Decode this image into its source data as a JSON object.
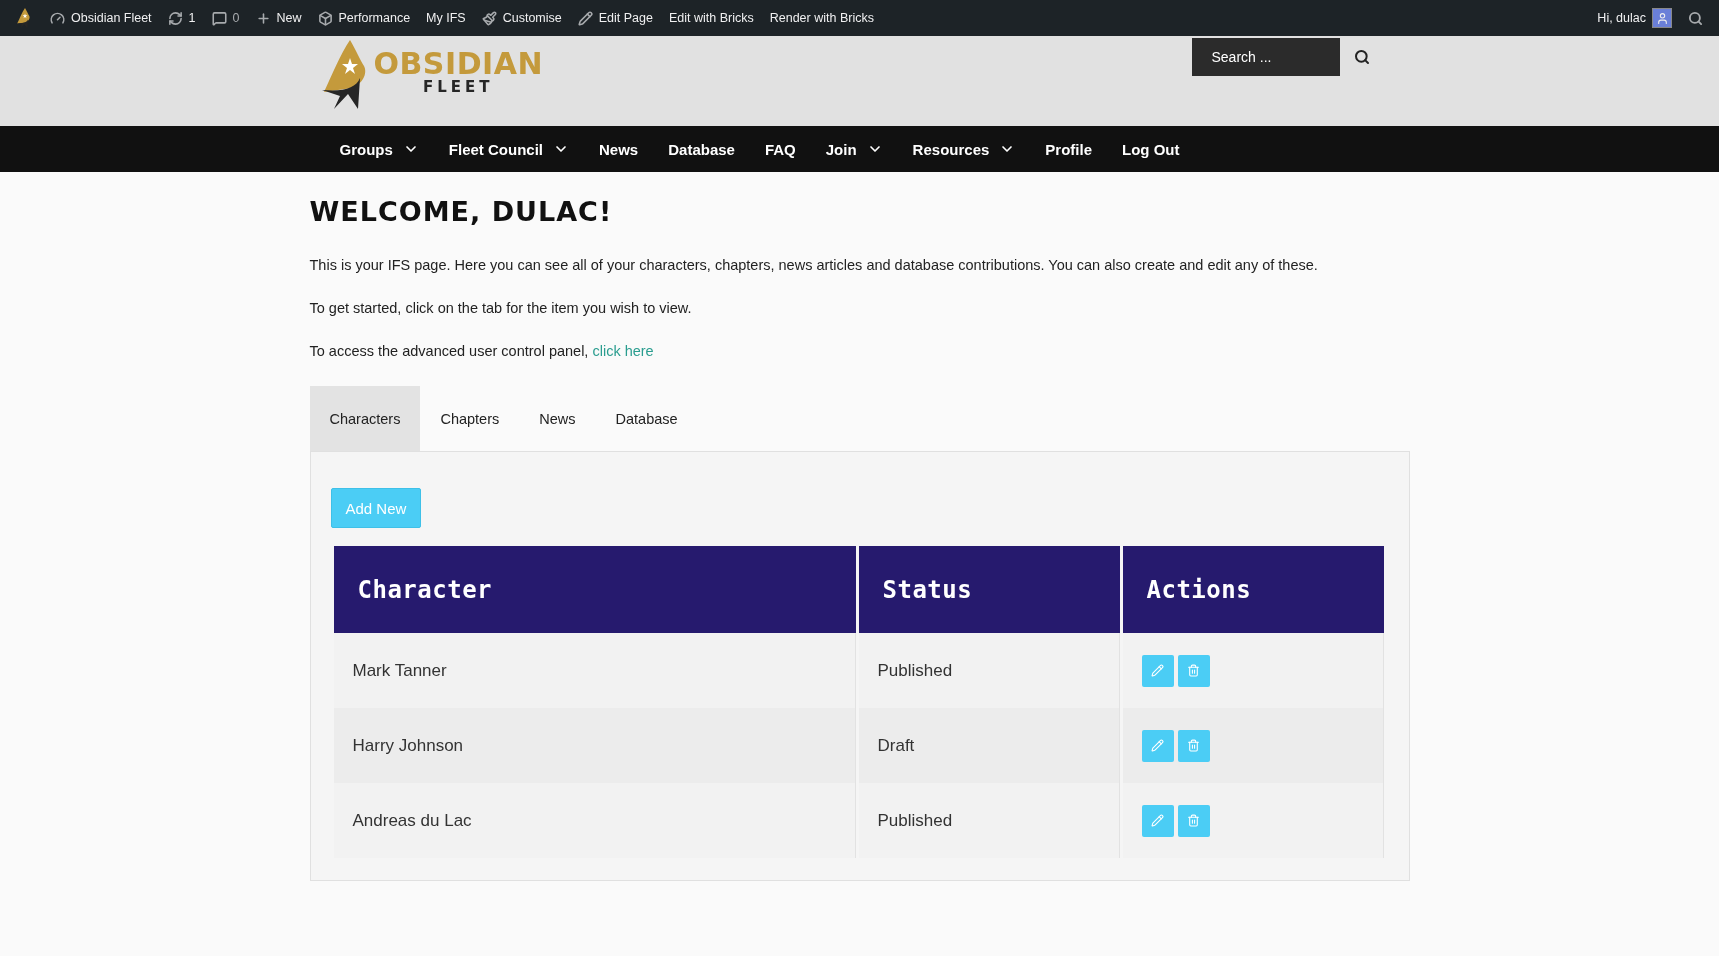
{
  "admin_bar": {
    "items": [
      {
        "label": "Obsidian Fleet"
      },
      {
        "label": "1"
      },
      {
        "label": "0"
      },
      {
        "label": "New"
      },
      {
        "label": "Performance"
      },
      {
        "label": "My IFS"
      },
      {
        "label": "Customise"
      },
      {
        "label": "Edit Page"
      },
      {
        "label": "Edit with Bricks"
      },
      {
        "label": "Render with Bricks"
      }
    ],
    "greeting": "Hi, dulac"
  },
  "header": {
    "logo_title": "OBSIDIAN",
    "logo_subtitle": "FLEET",
    "search": {
      "placeholder": "Search ..."
    }
  },
  "nav": [
    {
      "label": "Groups",
      "has_dropdown": true
    },
    {
      "label": "Fleet Council",
      "has_dropdown": true
    },
    {
      "label": "News",
      "has_dropdown": false
    },
    {
      "label": "Database",
      "has_dropdown": false
    },
    {
      "label": "FAQ",
      "has_dropdown": false
    },
    {
      "label": "Join",
      "has_dropdown": true
    },
    {
      "label": "Resources",
      "has_dropdown": true
    },
    {
      "label": "Profile",
      "has_dropdown": false
    },
    {
      "label": "Log Out",
      "has_dropdown": false
    }
  ],
  "page": {
    "title": "WELCOME, DULAC!",
    "intro": "This is your IFS page. Here you can see all of your characters, chapters, news articles and database contributions. You can also create and edit any of these.",
    "hint": "To get started, click on the tab for the item you wish to view.",
    "panel_text": "To access the advanced user control panel,",
    "panel_link": "click here"
  },
  "tabs": [
    {
      "label": "Characters",
      "selected": true
    },
    {
      "label": "Chapters",
      "selected": false
    },
    {
      "label": "News",
      "selected": false
    },
    {
      "label": "Database",
      "selected": false
    }
  ],
  "add_button": "Add New",
  "table": {
    "columns": [
      "Character",
      "Status",
      "Actions"
    ],
    "rows": [
      {
        "character": "Mark Tanner",
        "status": "Published"
      },
      {
        "character": "Harry Johnson",
        "status": "Draft"
      },
      {
        "character": "Andreas du Lac",
        "status": "Published"
      }
    ]
  }
}
